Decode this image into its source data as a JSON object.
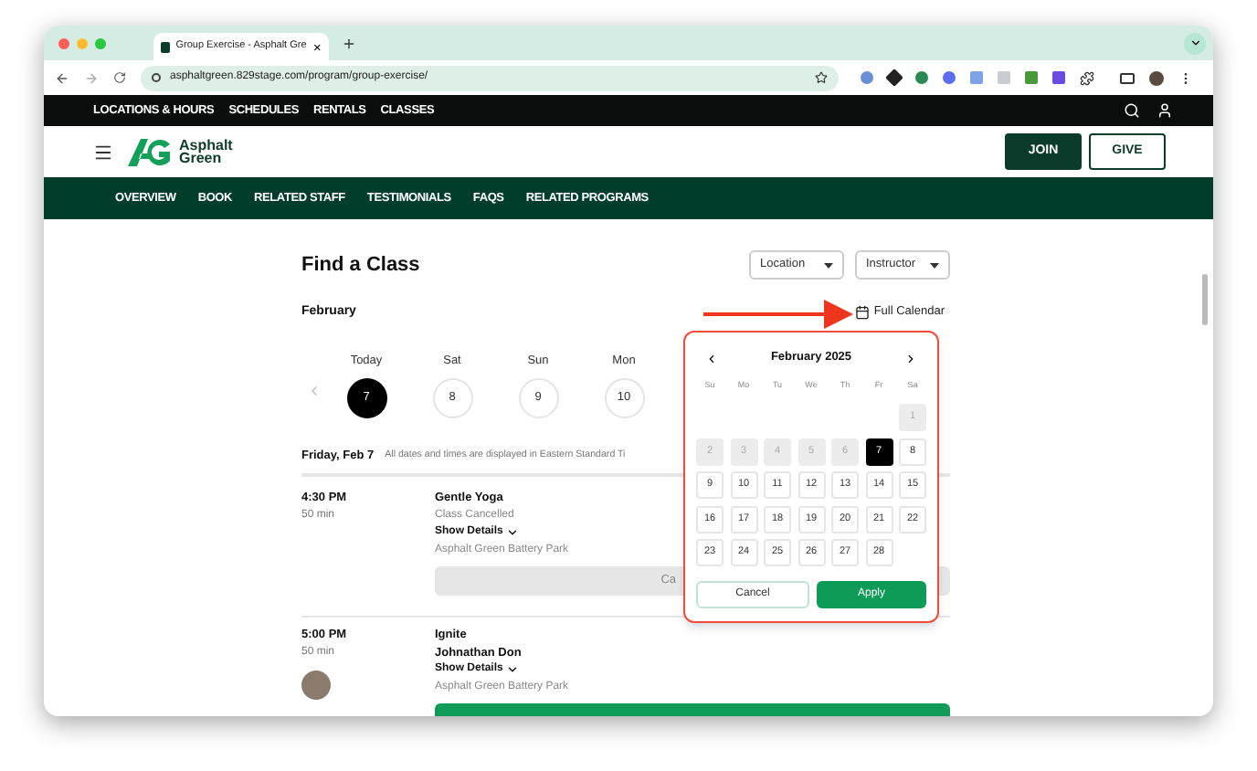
{
  "browser": {
    "tab_title": "Group Exercise - Asphalt Gre",
    "url": "asphaltgreen.829stage.com/program/group-exercise/"
  },
  "top_nav": [
    "LOCATIONS & HOURS",
    "SCHEDULES",
    "RENTALS",
    "CLASSES"
  ],
  "header": {
    "logo_text": "Asphalt Green",
    "buttons": [
      {
        "label": "JOIN",
        "kind": "primary"
      },
      {
        "label": "GIVE",
        "kind": "outline"
      }
    ]
  },
  "sub_nav": [
    "OVERVIEW",
    "BOOK",
    "RELATED STAFF",
    "TESTIMONIALS",
    "FAQS",
    "RELATED PROGRAMS"
  ],
  "find_class": {
    "title": "Find a Class",
    "filters": [
      "Location",
      "Instructor"
    ],
    "month": "February",
    "full_calendar": "Full Calendar",
    "days": [
      {
        "weekday": "Today",
        "date": "7",
        "selected": true
      },
      {
        "weekday": "Sat",
        "date": "8",
        "selected": false
      },
      {
        "weekday": "Sun",
        "date": "9",
        "selected": false
      },
      {
        "weekday": "Mon",
        "date": "10",
        "selected": false
      }
    ],
    "date_heading": "Friday, Feb 7",
    "timezone_note": "All dates and times are displayed in Eastern Standard Ti",
    "classes": [
      {
        "time": "4:30 PM",
        "duration": "50 min",
        "avatar": false,
        "name": "Gentle Yoga",
        "status": "Class Cancelled",
        "details": "Show Details",
        "location": "Asphalt Green Battery Park",
        "button": {
          "label": "Ca",
          "kind": "cancelled"
        }
      },
      {
        "time": "5:00 PM",
        "duration": "50 min",
        "avatar": true,
        "name": "Ignite",
        "instructor": "Johnathan Don",
        "details": "Show Details",
        "location": "Asphalt Green Battery Park",
        "button": {
          "kind": "book"
        }
      }
    ]
  },
  "calendar_popup": {
    "month": "February 2025",
    "weekdays": [
      "Su",
      "Mo",
      "Tu",
      "We",
      "Th",
      "Fr",
      "Sa"
    ],
    "cells": [
      {
        "kind": "blank"
      },
      {
        "kind": "blank"
      },
      {
        "kind": "blank"
      },
      {
        "kind": "blank"
      },
      {
        "kind": "blank"
      },
      {
        "kind": "blank"
      },
      {
        "kind": "day",
        "label": "1",
        "disabled": true,
        "selected": false
      },
      {
        "kind": "day",
        "label": "2",
        "disabled": true,
        "selected": false
      },
      {
        "kind": "day",
        "label": "3",
        "disabled": true,
        "selected": false
      },
      {
        "kind": "day",
        "label": "4",
        "disabled": true,
        "selected": false
      },
      {
        "kind": "day",
        "label": "5",
        "disabled": true,
        "selected": false
      },
      {
        "kind": "day",
        "label": "6",
        "disabled": true,
        "selected": false
      },
      {
        "kind": "day",
        "label": "7",
        "disabled": false,
        "selected": true
      },
      {
        "kind": "day",
        "label": "8",
        "disabled": false,
        "selected": false
      },
      {
        "kind": "day",
        "label": "9",
        "disabled": false,
        "selected": false
      },
      {
        "kind": "day",
        "label": "10",
        "disabled": false,
        "selected": false
      },
      {
        "kind": "day",
        "label": "11",
        "disabled": false,
        "selected": false
      },
      {
        "kind": "day",
        "label": "12",
        "disabled": false,
        "selected": false
      },
      {
        "kind": "day",
        "label": "13",
        "disabled": false,
        "selected": false
      },
      {
        "kind": "day",
        "label": "14",
        "disabled": false,
        "selected": false
      },
      {
        "kind": "day",
        "label": "15",
        "disabled": false,
        "selected": false
      },
      {
        "kind": "day",
        "label": "16",
        "disabled": false,
        "selected": false
      },
      {
        "kind": "day",
        "label": "17",
        "disabled": false,
        "selected": false
      },
      {
        "kind": "day",
        "label": "18",
        "disabled": false,
        "selected": false
      },
      {
        "kind": "day",
        "label": "19",
        "disabled": false,
        "selected": false
      },
      {
        "kind": "day",
        "label": "20",
        "disabled": false,
        "selected": false
      },
      {
        "kind": "day",
        "label": "21",
        "disabled": false,
        "selected": false
      },
      {
        "kind": "day",
        "label": "22",
        "disabled": false,
        "selected": false
      },
      {
        "kind": "day",
        "label": "23",
        "disabled": false,
        "selected": false
      },
      {
        "kind": "day",
        "label": "24",
        "disabled": false,
        "selected": false
      },
      {
        "kind": "day",
        "label": "25",
        "disabled": false,
        "selected": false
      },
      {
        "kind": "day",
        "label": "26",
        "disabled": false,
        "selected": false
      },
      {
        "kind": "day",
        "label": "27",
        "disabled": false,
        "selected": false
      },
      {
        "kind": "day",
        "label": "28",
        "disabled": false,
        "selected": false
      }
    ],
    "buttons": [
      {
        "label": "Cancel",
        "kind": "secondary"
      },
      {
        "label": "Apply",
        "kind": "primary"
      }
    ]
  }
}
